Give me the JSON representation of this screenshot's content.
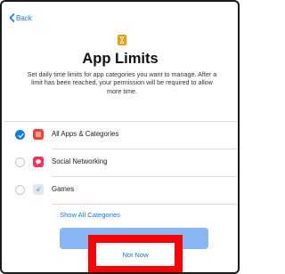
{
  "nav": {
    "back_label": "Back"
  },
  "header": {
    "title": "App Limits",
    "subtitle": "Set daily time limits for app categories you want to manage. After a limit has been reached, your permission will be required to allow more time."
  },
  "categories": [
    {
      "label": "All Apps & Categories",
      "selected": true,
      "icon": "stack-icon",
      "icon_color": "#ff3b30"
    },
    {
      "label": "Social Networking",
      "selected": false,
      "icon": "chat-bubble-icon",
      "icon_color": "#ff2d55"
    },
    {
      "label": "Games",
      "selected": false,
      "icon": "rocket-icon",
      "icon_color": "#e5e5ea"
    }
  ],
  "links": {
    "show_all": "Show All Categories"
  },
  "actions": {
    "primary_label": "",
    "not_now_label": "Not Now"
  },
  "colors": {
    "accent": "#0a7aff",
    "primary_button": "#88b7f3",
    "hourglass": "#ff9500",
    "highlight_box": "#ff0000"
  }
}
